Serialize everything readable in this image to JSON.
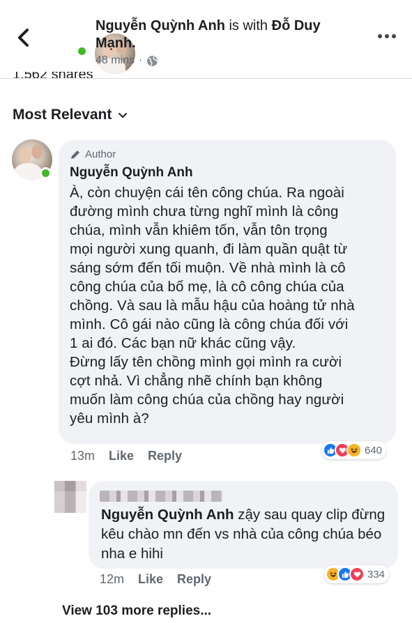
{
  "header": {
    "poster_name": "Nguyễn Quỳnh Anh",
    "with_text": "is with",
    "tagged_name": "Đỗ Duy Mạnh.",
    "time": "48 mins",
    "separator": "·",
    "shares_text": "1,562 shares"
  },
  "sort": {
    "label": "Most Relevant"
  },
  "comments": [
    {
      "badge": "Author",
      "name": "Nguyễn Quỳnh Anh",
      "text": "À, còn chuyện cái tên công chúa. Ra ngoài\nđường mình chưa từng nghĩ mình là công\nchúa, mình vẫn khiêm tốn, vẫn tôn trọng\nmọi người xung quanh, đi làm quần quật từ\nsáng sớm đến tối muộn. Về nhà mình là cô\ncông chúa của bố mẹ, là cô công chúa của\nchồng. Và sau là mẫu hậu của hoàng tử nhà\nmình. Cô gái nào cũng là công chúa đối với\n1 ai đó. Các bạn nữ khác cũng vậy.\nĐừng lấy tên chồng mình gọi mình ra cười\ncợt nhả. Vì chẳng nhẽ chính bạn không\nmuốn làm công chúa của chồng hay người\nyêu mình à?",
      "time": "13m",
      "like_label": "Like",
      "reply_label": "Reply",
      "reaction_count": "640"
    },
    {
      "mention": "Nguyễn Quỳnh Anh",
      "text": " zậy sau quay clip đừng kêu chào mn đến vs nhà của công chúa béo nha e hihi",
      "time": "12m",
      "like_label": "Like",
      "reply_label": "Reply",
      "reaction_count": "334"
    }
  ],
  "view_more": "View 103 more replies...",
  "icons": {
    "back": "chevron-left-icon",
    "more": "more-horizontal-icon",
    "privacy": "globe-icon",
    "sort": "chevron-down-icon",
    "author": "pencil-icon",
    "reactions": [
      "like-icon",
      "love-icon",
      "haha-icon"
    ]
  },
  "colors": {
    "online": "#42b72a",
    "bubble": "#f0f2f5",
    "like": "#1877f2",
    "love": "#f33e58",
    "haha": "#f7b125",
    "secondary_text": "#606770"
  }
}
